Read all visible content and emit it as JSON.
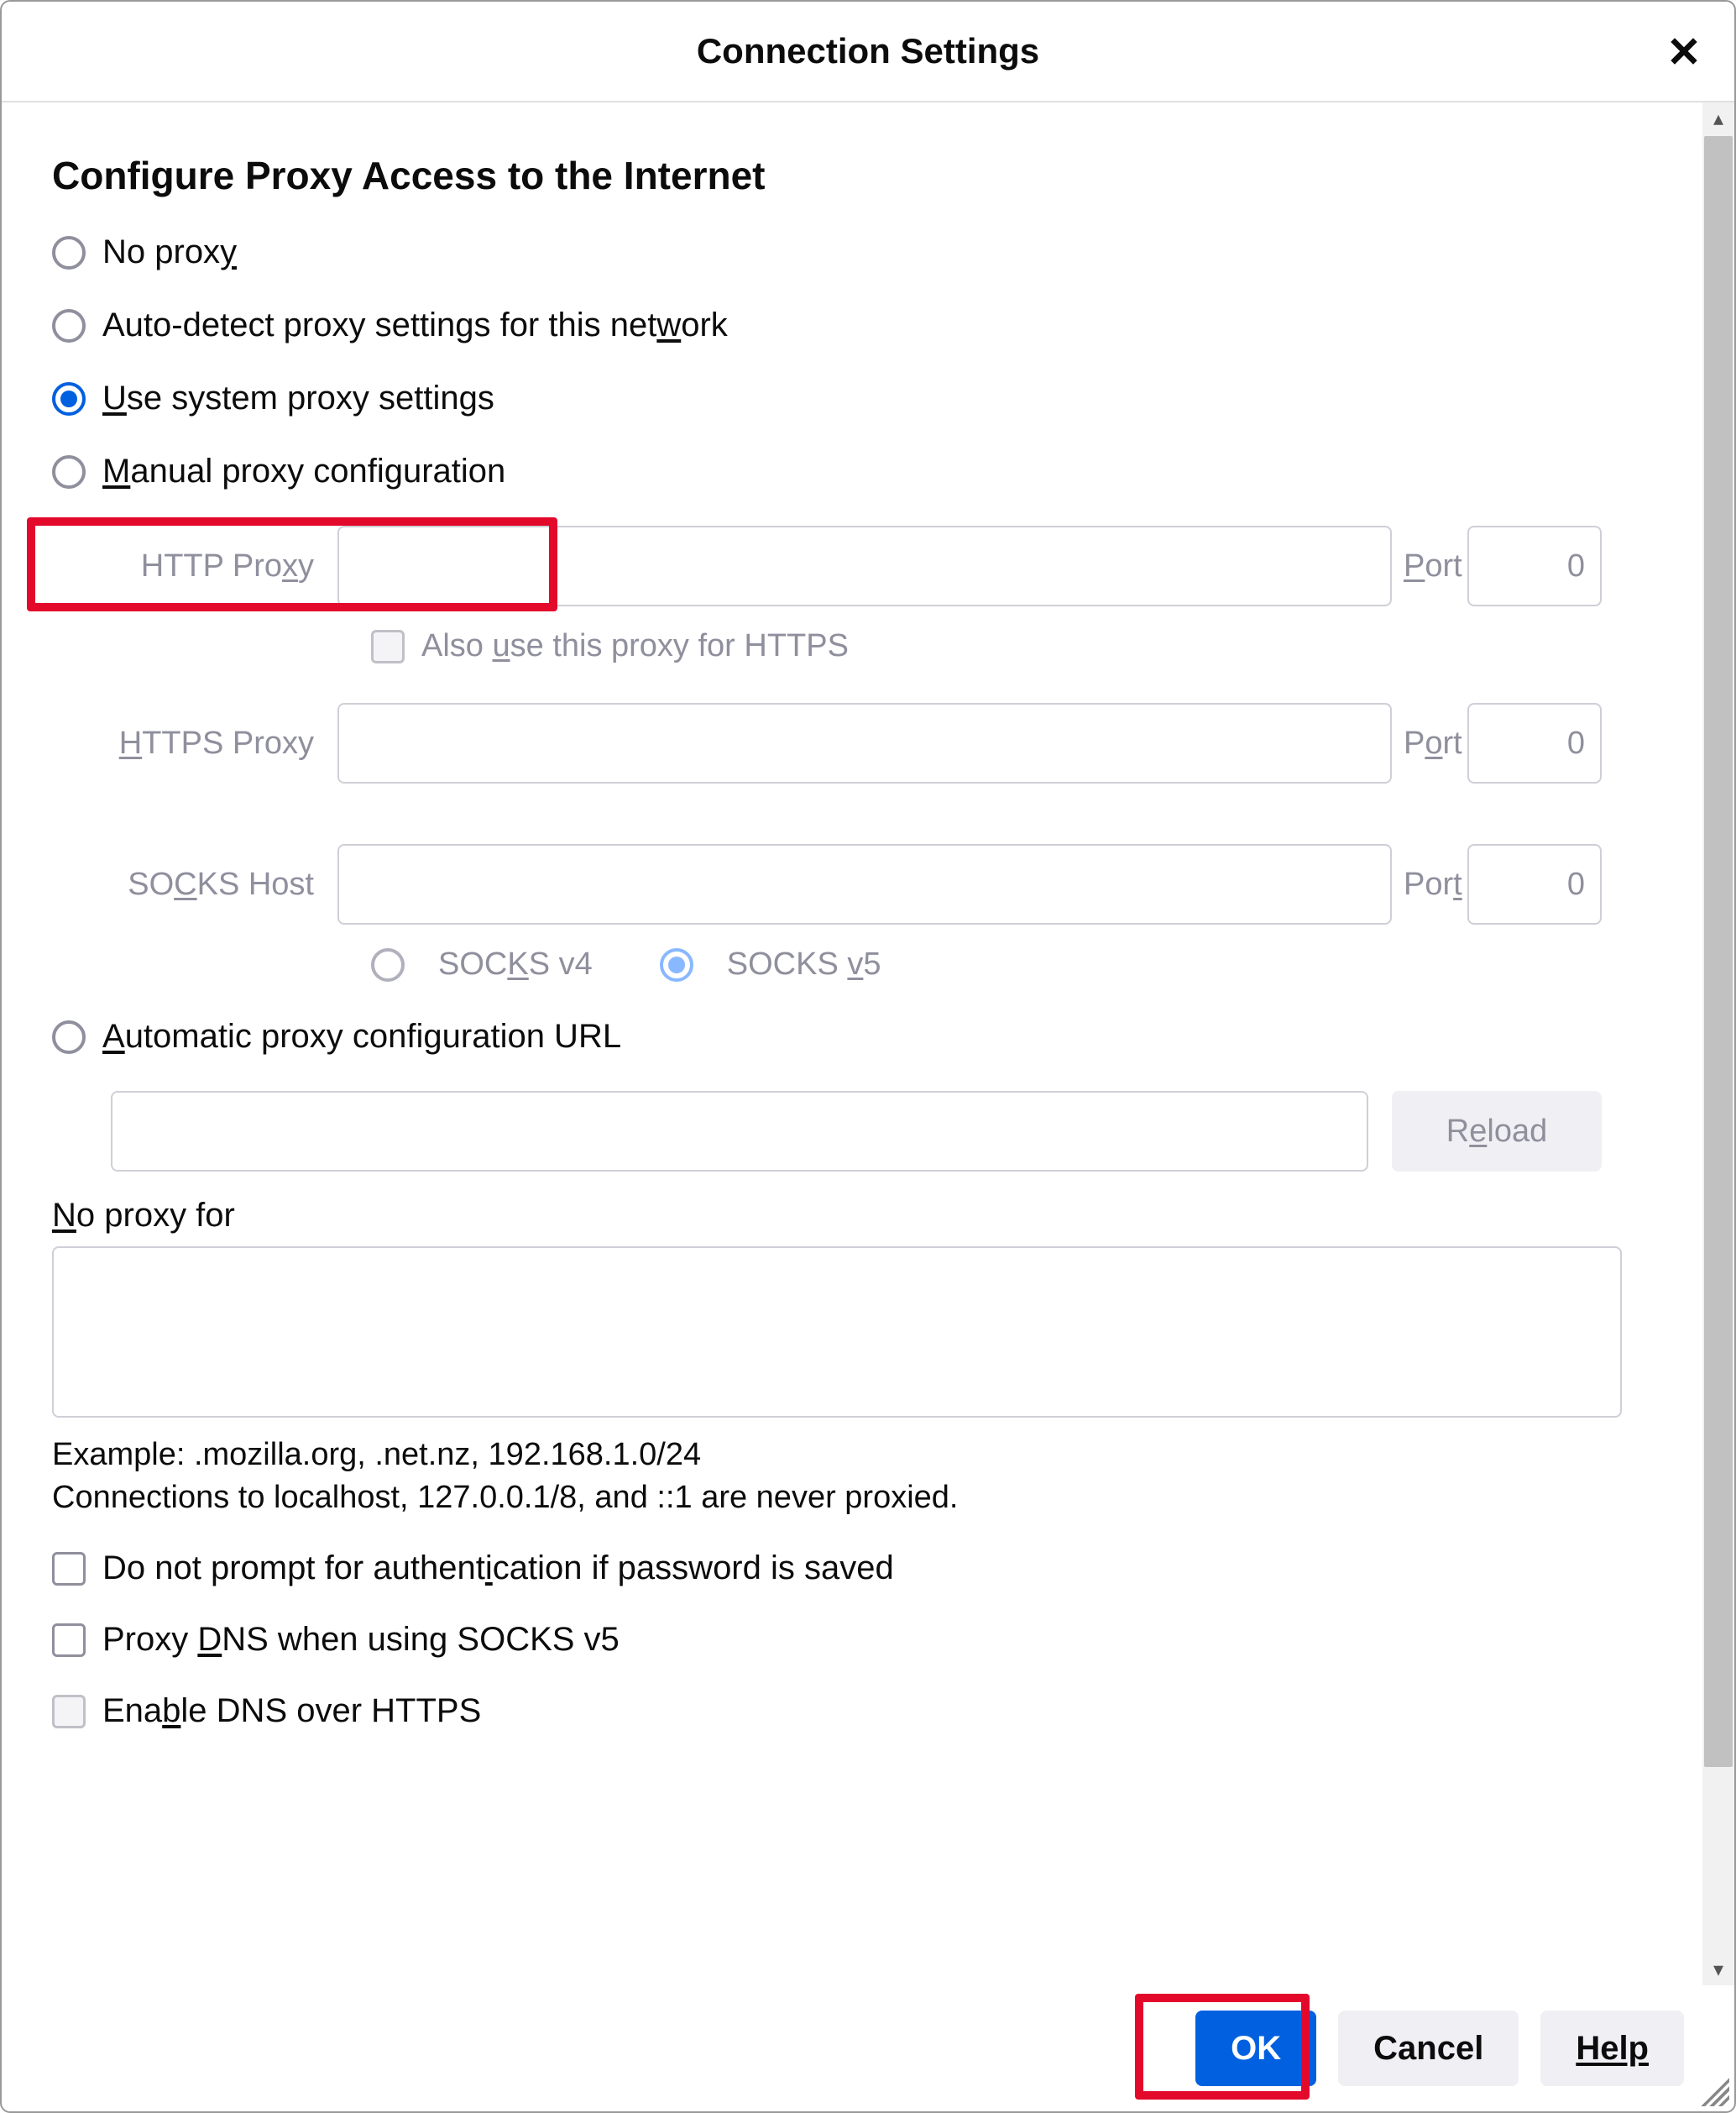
{
  "dialog": {
    "title": "Connection Settings",
    "section_title": "Configure Proxy Access to the Internet",
    "radios": {
      "no_proxy": "No prox",
      "no_proxy_suffix": "y",
      "auto_detect_pre": "Auto-detect proxy settings for this net",
      "auto_detect_u": "w",
      "auto_detect_post": "ork",
      "use_system_u": "U",
      "use_system_post": "se system proxy settings",
      "manual_u": "M",
      "manual_post": "anual proxy configuration",
      "auto_url_u": "A",
      "auto_url_post": "utomatic proxy configuration URL"
    },
    "labels": {
      "http_proxy_pre": "HTTP Pro",
      "http_proxy_u": "x",
      "http_proxy_post": "y",
      "port_u": "P",
      "port_post": "ort",
      "port2_pre": "P",
      "port2_u": "o",
      "port2_post": "rt",
      "port3_pre": "Por",
      "port3_u": "t",
      "https_proxy_u": "H",
      "https_proxy_post": "TTPS Proxy",
      "socks_host_pre": "SO",
      "socks_host_u": "C",
      "socks_host_post": "KS Host",
      "also_pre": "Also ",
      "also_u": "u",
      "also_post": "se this proxy for HTTPS",
      "socks4_pre": "SOC",
      "socks4_u": "K",
      "socks4_post": "S v4",
      "socks5_pre": "SOCKS ",
      "socks5_u": "v",
      "socks5_post": "5",
      "reload_pre": "R",
      "reload_u": "e",
      "reload_post": "load",
      "noproxy_u": "N",
      "noproxy_post": "o proxy for",
      "example": "Example: .mozilla.org, .net.nz, 192.168.1.0/24",
      "localhost_note": "Connections to localhost, 127.0.0.1/8, and ::1 are never proxied.",
      "auth_pre": "Do not prompt for authent",
      "auth_u": "i",
      "auth_post": "cation if password is saved",
      "proxy_dns_pre": "Proxy ",
      "proxy_dns_u": "D",
      "proxy_dns_post": "NS when using SOCKS v5",
      "enable_doh_pre": "Ena",
      "enable_doh_u": "b",
      "enable_doh_post": "le DNS over HTTPS"
    },
    "values": {
      "http_proxy": "",
      "http_port": "0",
      "https_proxy": "",
      "https_port": "0",
      "socks_host": "",
      "socks_port": "0",
      "auto_url": "",
      "no_proxy_for": ""
    },
    "buttons": {
      "ok": "OK",
      "cancel": "Cancel",
      "help": "Help"
    }
  }
}
